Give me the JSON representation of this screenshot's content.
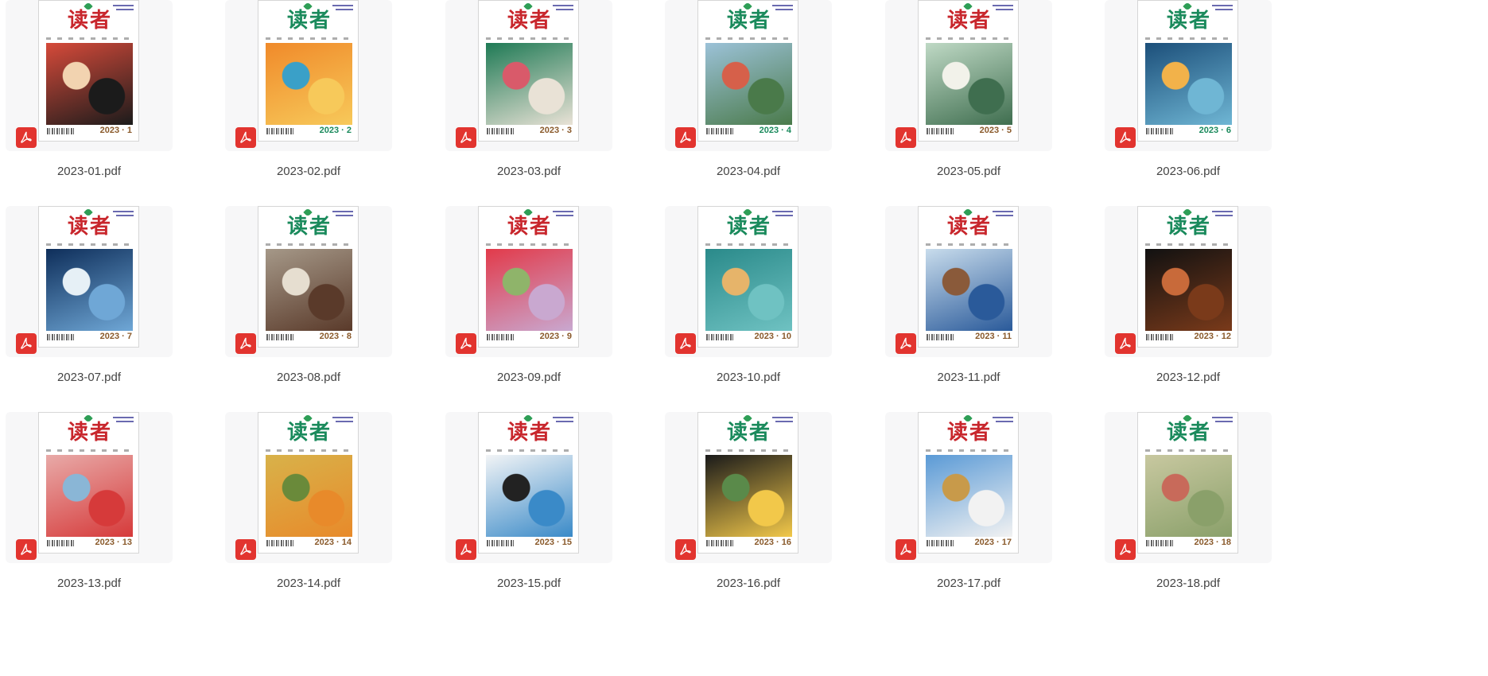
{
  "files": [
    {
      "name": "2023-01.pdf",
      "issue": "2023 · 1",
      "logo": "读者",
      "logo_color": "#c8262c",
      "issue_color": "#8a5a2b",
      "art": [
        "#d64a3a",
        "#1b1b1b",
        "#f2d3b0"
      ]
    },
    {
      "name": "2023-02.pdf",
      "issue": "2023 · 2",
      "logo": "读者",
      "logo_color": "#1a8a5c",
      "issue_color": "#1a8a5c",
      "art": [
        "#f08a2a",
        "#f7c95a",
        "#3aa0c8"
      ]
    },
    {
      "name": "2023-03.pdf",
      "issue": "2023 · 3",
      "logo": "读者",
      "logo_color": "#c8262c",
      "issue_color": "#8a5a2b",
      "art": [
        "#1f7a55",
        "#e9e2d6",
        "#d95a6a"
      ]
    },
    {
      "name": "2023-04.pdf",
      "issue": "2023 · 4",
      "logo": "读者",
      "logo_color": "#1a8a5c",
      "issue_color": "#1a8a5c",
      "art": [
        "#9cc2d8",
        "#4a7a4a",
        "#d6604a"
      ]
    },
    {
      "name": "2023-05.pdf",
      "issue": "2023 · 5",
      "logo": "读者",
      "logo_color": "#c8262c",
      "issue_color": "#8a5a2b",
      "art": [
        "#bfd9c5",
        "#3f6e4f",
        "#f2f2ea"
      ]
    },
    {
      "name": "2023-06.pdf",
      "issue": "2023 · 6",
      "logo": "读者",
      "logo_color": "#1a8a5c",
      "issue_color": "#1a8a5c",
      "art": [
        "#1c4f7a",
        "#6fb6d4",
        "#f2b24a"
      ]
    },
    {
      "name": "2023-07.pdf",
      "issue": "2023 · 7",
      "logo": "读者",
      "logo_color": "#c8262c",
      "issue_color": "#8a5a2b",
      "art": [
        "#0e2e5a",
        "#6fa7d6",
        "#e6f0f6"
      ]
    },
    {
      "name": "2023-08.pdf",
      "issue": "2023 · 8",
      "logo": "读者",
      "logo_color": "#1a8a5c",
      "issue_color": "#8a5a2b",
      "art": [
        "#a59888",
        "#5a3a2a",
        "#e6ded0"
      ]
    },
    {
      "name": "2023-09.pdf",
      "issue": "2023 · 9",
      "logo": "读者",
      "logo_color": "#c8262c",
      "issue_color": "#8a5a2b",
      "art": [
        "#e23a4a",
        "#c9a8d0",
        "#8fb46a"
      ]
    },
    {
      "name": "2023-10.pdf",
      "issue": "2023 · 10",
      "logo": "读者",
      "logo_color": "#1a8a5c",
      "issue_color": "#8a5a2b",
      "art": [
        "#2a8a8a",
        "#6fc2c2",
        "#e6b46a"
      ]
    },
    {
      "name": "2023-11.pdf",
      "issue": "2023 · 11",
      "logo": "读者",
      "logo_color": "#c8262c",
      "issue_color": "#8a5a2b",
      "art": [
        "#c8dcec",
        "#2a5a9a",
        "#8a5a3a"
      ]
    },
    {
      "name": "2023-12.pdf",
      "issue": "2023 · 12",
      "logo": "读者",
      "logo_color": "#1a8a5c",
      "issue_color": "#8a5a2b",
      "art": [
        "#111111",
        "#7a3a1a",
        "#c86a3a"
      ]
    },
    {
      "name": "2023-13.pdf",
      "issue": "2023 · 13",
      "logo": "读者",
      "logo_color": "#c8262c",
      "issue_color": "#8a5a2b",
      "art": [
        "#e8aaa8",
        "#d63a3a",
        "#8ab6d6"
      ]
    },
    {
      "name": "2023-14.pdf",
      "issue": "2023 · 14",
      "logo": "读者",
      "logo_color": "#1a8a5c",
      "issue_color": "#8a5a2b",
      "art": [
        "#d8b24a",
        "#e88a2a",
        "#6a8a3a"
      ]
    },
    {
      "name": "2023-15.pdf",
      "issue": "2023 · 15",
      "logo": "读者",
      "logo_color": "#c8262c",
      "issue_color": "#8a5a2b",
      "art": [
        "#f2f4f6",
        "#3a8ac8",
        "#222222"
      ]
    },
    {
      "name": "2023-16.pdf",
      "issue": "2023 · 16",
      "logo": "读者",
      "logo_color": "#1a8a5c",
      "issue_color": "#8a5a2b",
      "art": [
        "#1a1a1a",
        "#f2c84a",
        "#5a8a4a"
      ]
    },
    {
      "name": "2023-17.pdf",
      "issue": "2023 · 17",
      "logo": "读者",
      "logo_color": "#c8262c",
      "issue_color": "#8a5a2b",
      "art": [
        "#5a9ad6",
        "#f2f2f2",
        "#c89a4a"
      ]
    },
    {
      "name": "2023-18.pdf",
      "issue": "2023 · 18",
      "logo": "读者",
      "logo_color": "#1a8a5c",
      "issue_color": "#8a5a2b",
      "art": [
        "#c8c8a0",
        "#8aa06a",
        "#c86a5a"
      ]
    }
  ],
  "icons": {
    "file_type_icon": "pdf-icon"
  },
  "colors": {
    "pdf_badge": "#e2342f",
    "tile_bg": "#f7f7f8"
  }
}
